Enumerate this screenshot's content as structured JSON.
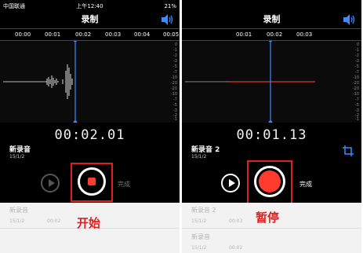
{
  "status_bar": {
    "carrier": "中国联通",
    "time": "上午12:40",
    "battery": "21%"
  },
  "left": {
    "title": "录制",
    "ticks": [
      "00:00",
      "00:01",
      "00:02",
      "00:03",
      "00:04",
      "00:05"
    ],
    "db_scale": [
      "0",
      "-1",
      "-2",
      "-3",
      "-5",
      "-7",
      "-10",
      "-20",
      "-20",
      "-10",
      "-7",
      "-5",
      "-3",
      "-2",
      "-1",
      "0"
    ],
    "timer": "00:02.01",
    "recording_name": "新录音",
    "recording_date": "15/1/2",
    "done_label": "完成",
    "caption": "开始",
    "list": [
      {
        "name": "新录音",
        "date": "15/1/2",
        "duration": "00:02"
      }
    ]
  },
  "right": {
    "title": "录制",
    "ticks": [
      "00:01",
      "00:02",
      "00:03"
    ],
    "db_scale": [
      "0",
      "-1",
      "-2",
      "-3",
      "-5",
      "-7",
      "-10",
      "-20",
      "-20",
      "-10",
      "-7",
      "-5",
      "-3",
      "-2",
      "-1",
      "0"
    ],
    "timer": "00:01.13",
    "recording_name": "新录音 2",
    "recording_date": "15/1/2",
    "done_label": "完成",
    "caption": "暂停",
    "list": [
      {
        "name": "新录音 2",
        "date": "15/1/2",
        "duration": "00:03"
      },
      {
        "name": "新录音",
        "date": "15/1/2",
        "duration": "00:02"
      }
    ]
  },
  "colors": {
    "accent_red": "#e02020",
    "record_red": "#ff3b30",
    "playhead_blue": "#3a8cff",
    "background": "#000000"
  }
}
